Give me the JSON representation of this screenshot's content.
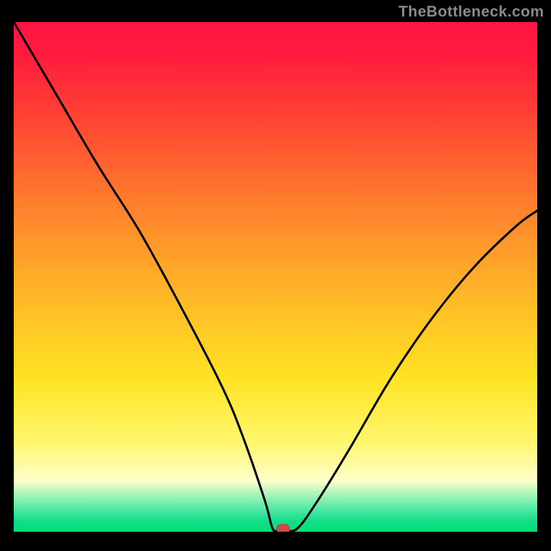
{
  "attribution": "TheBottleneck.com",
  "chart_data": {
    "type": "line",
    "title": "",
    "xlabel": "",
    "ylabel": "",
    "xlim": [
      0,
      100
    ],
    "ylim": [
      0,
      100
    ],
    "grid": false,
    "legend": false,
    "series": [
      {
        "name": "bottleneck-curve",
        "x": [
          0,
          8,
          16,
          24,
          32,
          40,
          44,
          48,
          49.5,
          51,
          54,
          58,
          64,
          72,
          80,
          88,
          96,
          100
        ],
        "values": [
          100,
          86,
          72,
          59,
          44,
          28,
          18,
          6,
          0.5,
          0.5,
          0.5,
          6,
          16,
          30,
          42,
          52,
          60,
          63
        ]
      }
    ],
    "marker": {
      "x": 51.5,
      "y": 0.5,
      "color": "#d24a45"
    },
    "background_gradient": {
      "top": "#ff1445",
      "mid": "#ffe323",
      "bottom": "#00e177"
    }
  }
}
